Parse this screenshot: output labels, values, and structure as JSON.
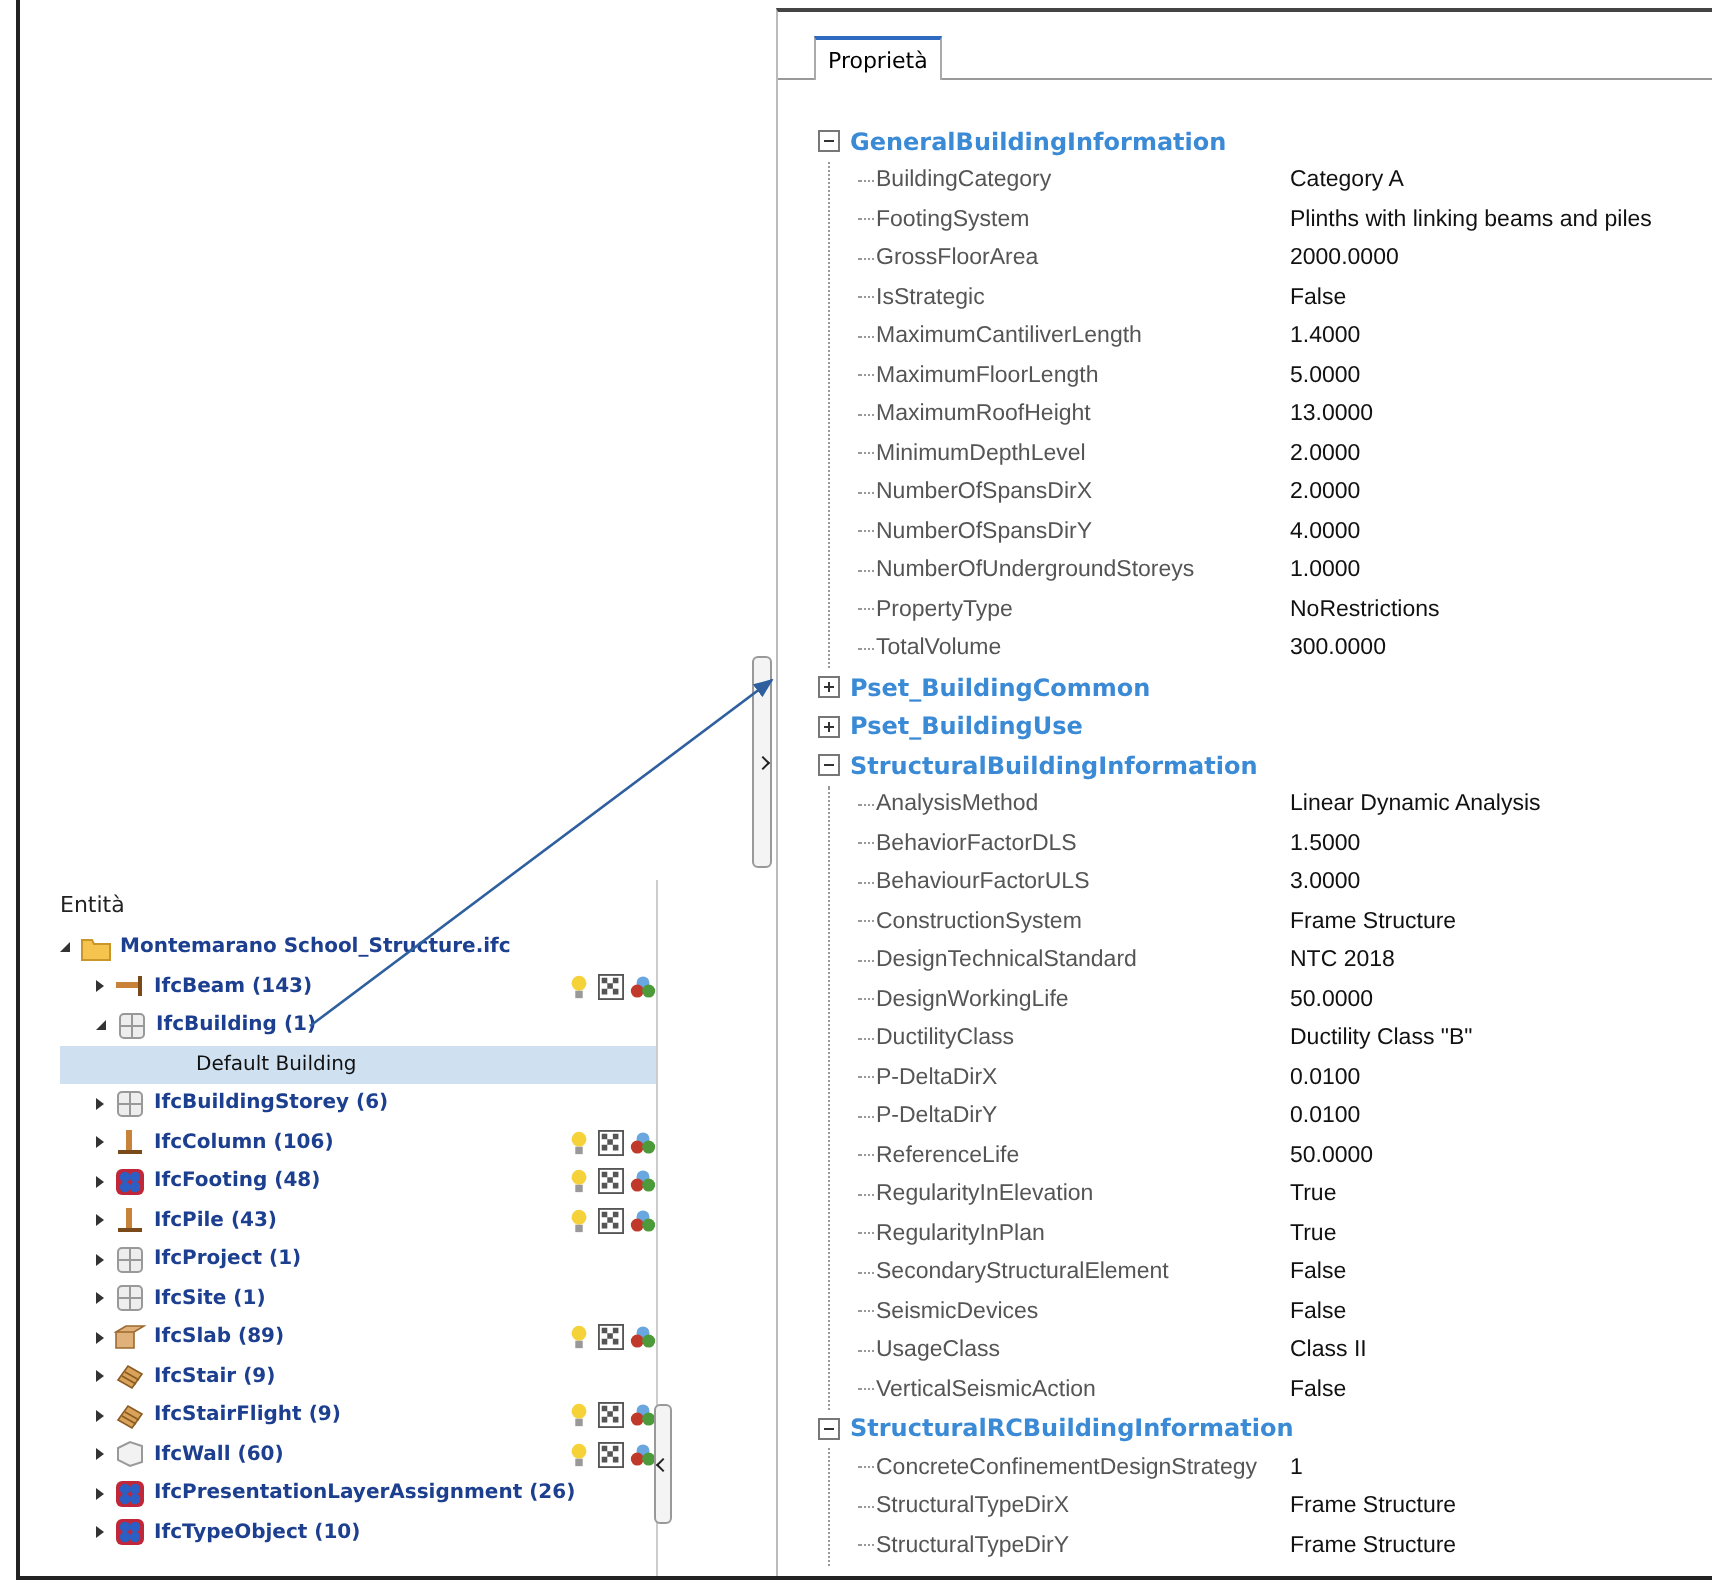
{
  "entities": {
    "title": "Entità",
    "root": {
      "label": "Montemarano School_Structure.ifc",
      "expanded": true,
      "children": [
        {
          "label": "IfcBeam (143)",
          "kind": "beam",
          "expanded": false,
          "actions": true
        },
        {
          "label": "IfcBuilding (1)",
          "kind": "grid",
          "expanded": true,
          "actions": false,
          "children": [
            {
              "label": "Default Building",
              "selected": true
            }
          ]
        },
        {
          "label": "IfcBuildingStorey (6)",
          "kind": "grid",
          "expanded": false,
          "actions": false
        },
        {
          "label": "IfcColumn (106)",
          "kind": "column",
          "expanded": false,
          "actions": true
        },
        {
          "label": "IfcFooting (48)",
          "kind": "layer",
          "expanded": false,
          "actions": true
        },
        {
          "label": "IfcPile (43)",
          "kind": "column",
          "expanded": false,
          "actions": true
        },
        {
          "label": "IfcProject (1)",
          "kind": "grid",
          "expanded": false,
          "actions": false
        },
        {
          "label": "IfcSite (1)",
          "kind": "grid",
          "expanded": false,
          "actions": false
        },
        {
          "label": "IfcSlab (89)",
          "kind": "slab",
          "expanded": false,
          "actions": true
        },
        {
          "label": "IfcStair (9)",
          "kind": "stair",
          "expanded": false,
          "actions": false
        },
        {
          "label": "IfcStairFlight (9)",
          "kind": "stair",
          "expanded": false,
          "actions": true
        },
        {
          "label": "IfcWall (60)",
          "kind": "wall",
          "expanded": false,
          "actions": true
        },
        {
          "label": "IfcPresentationLayerAssignment (26)",
          "kind": "layer",
          "expanded": false,
          "actions": false
        },
        {
          "label": "IfcTypeObject (10)",
          "kind": "layer",
          "expanded": false,
          "actions": false
        }
      ]
    }
  },
  "properties": {
    "tab": {
      "label": "Proprietà",
      "selected": true
    },
    "groups": [
      {
        "name": "GeneralBuildingInformation",
        "expanded": true,
        "properties": [
          {
            "name": "BuildingCategory",
            "value": "Category A"
          },
          {
            "name": "FootingSystem",
            "value": "Plinths with linking beams and piles"
          },
          {
            "name": "GrossFloorArea",
            "value": "2000.0000"
          },
          {
            "name": "IsStrategic",
            "value": "False"
          },
          {
            "name": "MaximumCantiliverLength",
            "value": "1.4000"
          },
          {
            "name": "MaximumFloorLength",
            "value": "5.0000"
          },
          {
            "name": "MaximumRoofHeight",
            "value": "13.0000"
          },
          {
            "name": "MinimumDepthLevel",
            "value": "2.0000"
          },
          {
            "name": "NumberOfSpansDirX",
            "value": "2.0000"
          },
          {
            "name": "NumberOfSpansDirY",
            "value": "4.0000"
          },
          {
            "name": "NumberOfUndergroundStoreys",
            "value": "1.0000"
          },
          {
            "name": "PropertyType",
            "value": "NoRestrictions"
          },
          {
            "name": "TotalVolume",
            "value": "300.0000"
          }
        ]
      },
      {
        "name": "Pset_BuildingCommon",
        "expanded": false
      },
      {
        "name": "Pset_BuildingUse",
        "expanded": false
      },
      {
        "name": "StructuralBuildingInformation",
        "expanded": true,
        "properties": [
          {
            "name": "AnalysisMethod",
            "value": "Linear Dynamic Analysis"
          },
          {
            "name": "BehaviorFactorDLS",
            "value": "1.5000"
          },
          {
            "name": "BehaviourFactorULS",
            "value": "3.0000"
          },
          {
            "name": "ConstructionSystem",
            "value": "Frame Structure"
          },
          {
            "name": "DesignTechnicalStandard",
            "value": "NTC 2018"
          },
          {
            "name": "DesignWorkingLife",
            "value": "50.0000"
          },
          {
            "name": "DuctilityClass",
            "value": "Ductility Class \"B\""
          },
          {
            "name": "P-DeltaDirX",
            "value": "0.0100"
          },
          {
            "name": "P-DeltaDirY",
            "value": "0.0100"
          },
          {
            "name": "ReferenceLife",
            "value": "50.0000"
          },
          {
            "name": "RegularityInElevation",
            "value": "True"
          },
          {
            "name": "RegularityInPlan",
            "value": "True"
          },
          {
            "name": "SecondaryStructuralElement",
            "value": "False"
          },
          {
            "name": "SeismicDevices",
            "value": "False"
          },
          {
            "name": "UsageClass",
            "value": "Class II"
          },
          {
            "name": "VerticalSeismicAction",
            "value": "False"
          }
        ]
      },
      {
        "name": "StructuralRCBuildingInformation",
        "expanded": true,
        "properties": [
          {
            "name": "ConcreteConfinementDesignStrategy",
            "value": "1"
          },
          {
            "name": "StructuralTypeDirX",
            "value": "Frame Structure"
          },
          {
            "name": "StructuralTypeDirY",
            "value": "Frame Structure"
          }
        ]
      }
    ]
  }
}
